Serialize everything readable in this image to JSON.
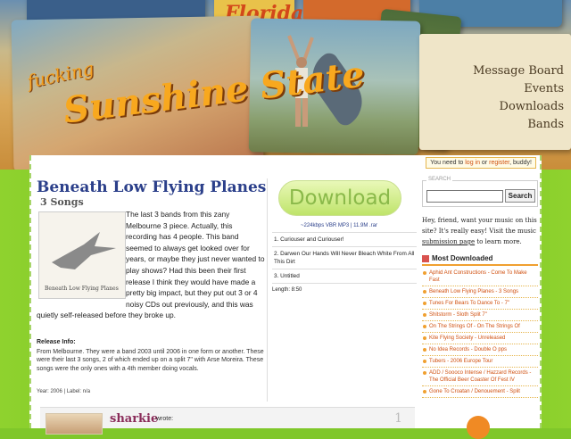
{
  "header": {
    "logo_line1": "fucking",
    "logo_line2": "Sunshine State",
    "postcard_text": "Florida",
    "nav": [
      "Message Board",
      "Events",
      "Downloads",
      "Bands"
    ]
  },
  "loginbar": {
    "prefix": "You need to ",
    "login": "log in",
    "middle": " or ",
    "register": "register",
    "suffix": ", buddy!"
  },
  "album": {
    "title": "Beneath Low Flying Planes",
    "subtitle": "3 Songs",
    "art_label": "Beneath Low Flying Planes",
    "description": "The last 3 bands from this zany Melbourne 3 piece. Actually, this recording has 4 people. This band seemed to always get looked over for years, or maybe they just never wanted to play shows? Had this been their first release I think they would have made a pretty big impact, but they put out 3 or 4 noisy CDs out previously, and this was quietly self-released before they broke up.",
    "release_heading": "Release Info:",
    "release_text": "From Melbourne. They were a band 2003 until 2006 in one form or another. These were their last 3 songs, 2 of which ended up on a split 7\" with Arse Moreira. These songs were the only ones with a 4th member doing vocals.",
    "release_meta": "Year: 2006 | Label: n/a"
  },
  "download": {
    "button": "Download",
    "info": "~224kbps VBR MP3 | 11.9M .rar",
    "tracks": [
      "1. Curiouser and Curiouser!",
      "2. Darwen Our Hands Will Never Bleach White From All This Dirt",
      "3. Untitled"
    ],
    "length": "Length: 8:50"
  },
  "comment": {
    "user": "sharkie",
    "wrote": "wrote:",
    "number": "1"
  },
  "sidebar": {
    "search_legend": "SEARCH",
    "search_value": "",
    "search_button": "Search",
    "note_text": "Hey, friend, want your music on this site? It's really easy! Visit the music ",
    "note_link": "submission page",
    "note_suffix": " to learn more.",
    "most_downloaded_heading": "Most Downloaded",
    "most_downloaded": [
      "Aphid Ant Constructions - Come To Make Fast",
      "Beneath Low Flying Planes - 3 Songs",
      "Tunes For Bears To Dance To - 7\"",
      "Shitstorm - Sloth Split 7\"",
      "On The Strings Of - On The Strings Of",
      "Kite Flying Society - Unreleased",
      "No Idea Records - Double O pps",
      "Tubers - 2006 Europe Tour",
      "ADD / Soooco Intense / Hazzard Records - The Official Beer Coaster Of Fest IV",
      "Gone To Croatan / Denouement - Split"
    ]
  },
  "colors": {
    "background": "#7fc72a",
    "title": "#2b3f8a",
    "link": "#d05010",
    "accent": "#f0a030"
  }
}
